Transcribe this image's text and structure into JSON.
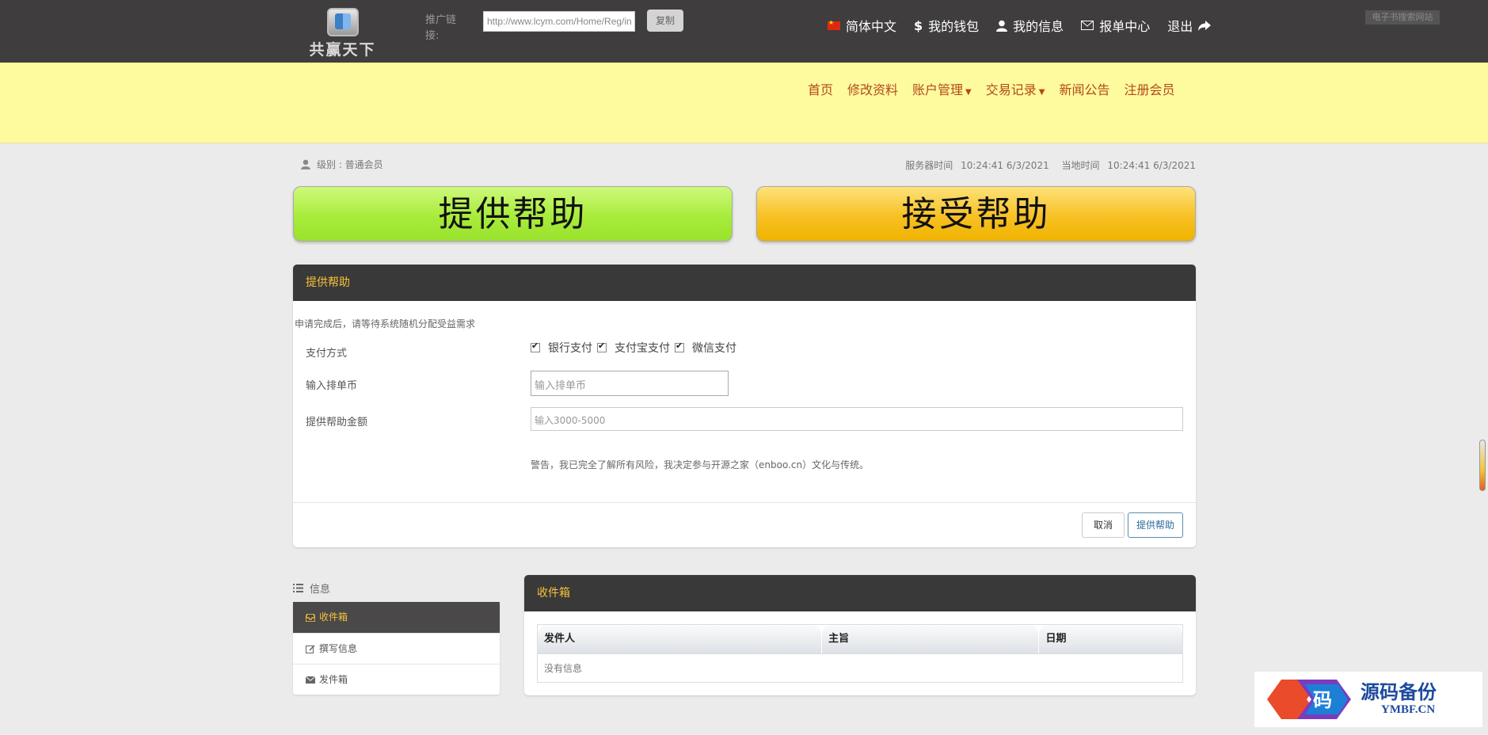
{
  "header": {
    "logo_text": "共赢天下",
    "promo_label": "推广链接:",
    "promo_url": "http://www.lcym.com/Home/Reg/in",
    "copy_label": "复制",
    "lang_label": "简体中文",
    "wallet_label": "我的钱包",
    "info_label": "我的信息",
    "report_label": "报单中心",
    "logout_label": "退出",
    "watermark": "电子书搜索网站"
  },
  "nav": {
    "items": [
      "首页",
      "修改资料",
      "账户管理",
      "交易记录",
      "新闻公告",
      "注册会员"
    ]
  },
  "status": {
    "level": "级别 : 普通会员",
    "server_time_label": "服务器时间",
    "server_time": "10:24:41 6/3/2021",
    "local_time_label": "当地时间",
    "local_time": "10:24:41 6/3/2021"
  },
  "actions": {
    "give_label": "提供帮助",
    "take_label": "接受帮助"
  },
  "form": {
    "title": "提供帮助",
    "notice": "申请完成后，请等待系统随机分配受益需求",
    "pay_method_label": "支付方式",
    "pay_methods": [
      "银行支付",
      "支付宝支付",
      "微信支付"
    ],
    "coin_label": "输入排单币",
    "coin_placeholder": "输入排单币",
    "amount_label": "提供帮助金额",
    "amount_placeholder": "输入3000-5000",
    "warning": "警告，我已完全了解所有风险，我决定参与开源之家（enboo.cn）文化与传统。",
    "cancel_label": "取消",
    "submit_label": "提供帮助"
  },
  "sidebar": {
    "title": "信息",
    "items": [
      {
        "label": "收件箱",
        "icon": "inbox-icon",
        "active": true
      },
      {
        "label": "撰写信息",
        "icon": "edit-icon",
        "active": false
      },
      {
        "label": "发件箱",
        "icon": "envelope-icon",
        "active": false
      }
    ]
  },
  "inbox": {
    "title": "收件箱",
    "columns": [
      "发件人",
      "主旨",
      "日期"
    ],
    "empty_text": "没有信息"
  },
  "brand": {
    "cn": "源码备份",
    "en": "YMBF.CN",
    "mark": "码"
  },
  "colors": {
    "topbar": "#3f3d3d",
    "yellowbar": "#fefa9e",
    "nav_text": "#b24a1b",
    "panel_title": "#f5c33b"
  }
}
